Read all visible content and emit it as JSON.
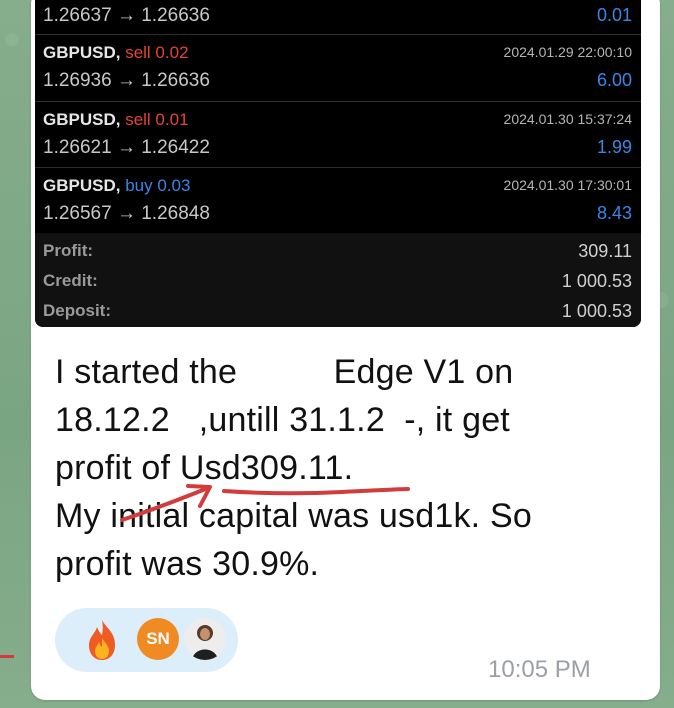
{
  "trades_top": {
    "prices": "1.26637 → 1.26636",
    "profit": "0.01"
  },
  "trades": [
    {
      "symbol": "GBPUSD,",
      "side": "sell 0.02",
      "side_type": "sell",
      "datetime": "2024.01.29 22:00:10",
      "prices": "1.26936 → 1.26636",
      "profit": "6.00"
    },
    {
      "symbol": "GBPUSD,",
      "side": "sell 0.01",
      "side_type": "sell",
      "datetime": "2024.01.30 15:37:24",
      "prices": "1.26621 → 1.26422",
      "profit": "1.99"
    },
    {
      "symbol": "GBPUSD,",
      "side": "buy 0.03",
      "side_type": "buy",
      "datetime": "2024.01.30 17:30:01",
      "prices": "1.26567 → 1.26848",
      "profit": "8.43"
    }
  ],
  "summary": [
    {
      "label": "Profit:",
      "value": "309.11"
    },
    {
      "label": "Credit:",
      "value": "1 000.53"
    },
    {
      "label": "Deposit:",
      "value": "1 000.53"
    }
  ],
  "message": {
    "lines": [
      "I started the          Edge V1 on",
      "18.12.2   ,untill 31.1.2  -, it get",
      "profit of Usd309.11.",
      "My initial capital was usd1k. So",
      "profit was 30.9%."
    ]
  },
  "reactions": {
    "emoji": "fire",
    "avatar_initials": "SN"
  },
  "timestamp": "10:05 PM",
  "colors": {
    "sell": "#e8413a",
    "buy": "#3a86e8",
    "bubble": "#ffffff",
    "chat_bg": "#7fa886",
    "annotation": "#d23c3c"
  }
}
